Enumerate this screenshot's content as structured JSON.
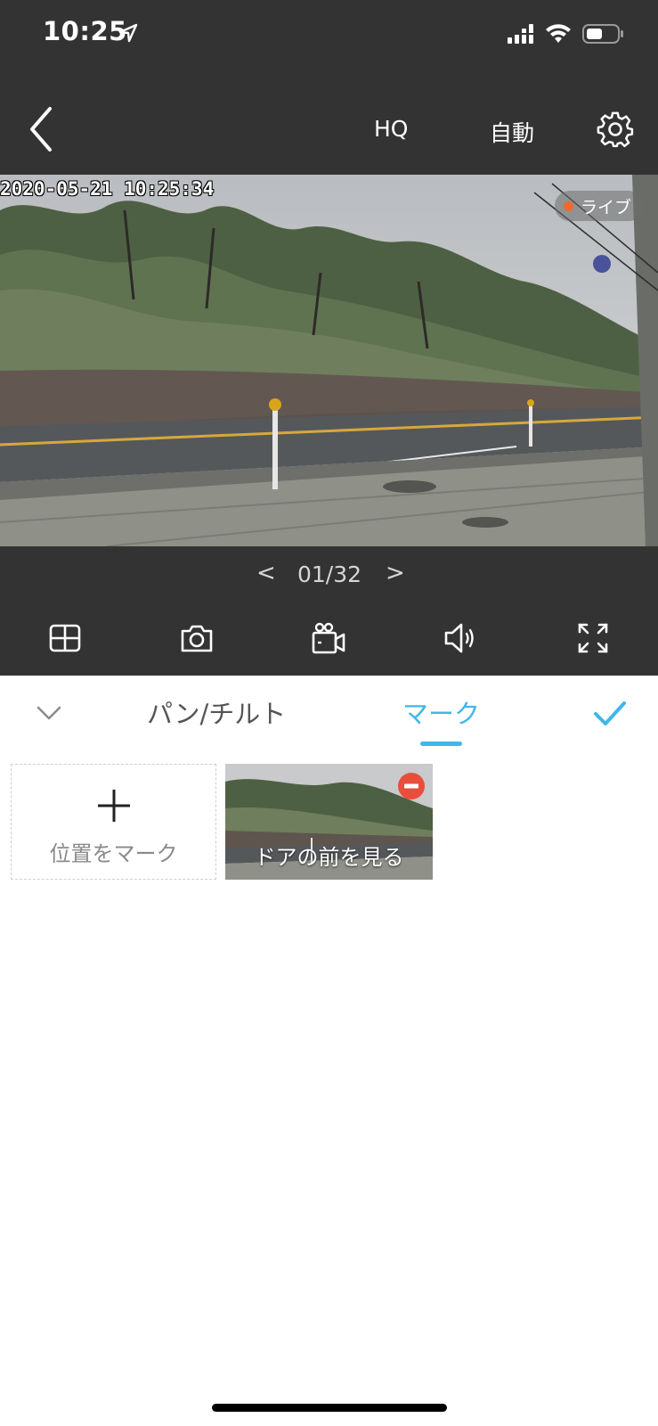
{
  "status_bar": {
    "time": "10:25"
  },
  "nav": {
    "quality": "HQ",
    "mode": "自動"
  },
  "video": {
    "timestamp": "2020-05-21 10:25:34",
    "live_label": "ライブ"
  },
  "pager": {
    "current": "01/32",
    "prev_symbol": "<",
    "next_symbol": ">"
  },
  "toolbar": {
    "icons": [
      "grid-layout-icon",
      "camera-icon",
      "video-record-icon",
      "speaker-icon",
      "fullscreen-icon"
    ]
  },
  "tabs": {
    "pan_tilt": "パン/チルト",
    "mark": "マーク",
    "active": "mark",
    "active_color": "#3fb7ea"
  },
  "marks": {
    "add_label": "位置をマーク",
    "items": [
      {
        "label": "ドアの前を見る"
      }
    ]
  },
  "colors": {
    "header_bg": "#333333",
    "accent": "#3fb7ea",
    "live_dot": "#f06a2c",
    "delete": "#e94e3c"
  }
}
